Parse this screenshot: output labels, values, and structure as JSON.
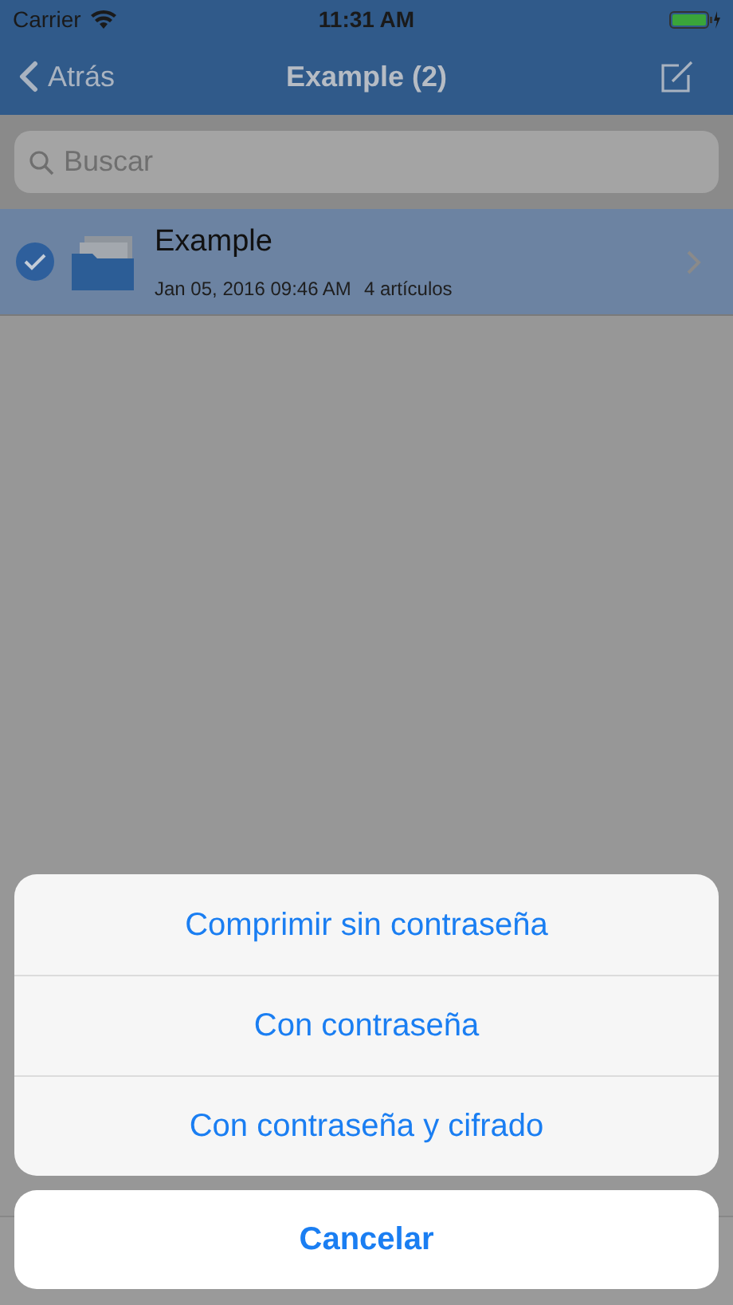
{
  "status_bar": {
    "carrier": "Carrier",
    "time": "11:31 AM"
  },
  "nav_bar": {
    "back": "Atrás",
    "title": "Example (2)"
  },
  "search": {
    "placeholder": "Buscar"
  },
  "files": [
    {
      "name": "Example",
      "date": "Jan 05, 2016 09:46 AM",
      "count": "4 artículos",
      "selected": true
    }
  ],
  "action_sheet": {
    "actions": [
      "Comprimir sin contraseña",
      "Con contraseña",
      "Con contraseña y cifrado"
    ],
    "cancel": "Cancelar"
  }
}
